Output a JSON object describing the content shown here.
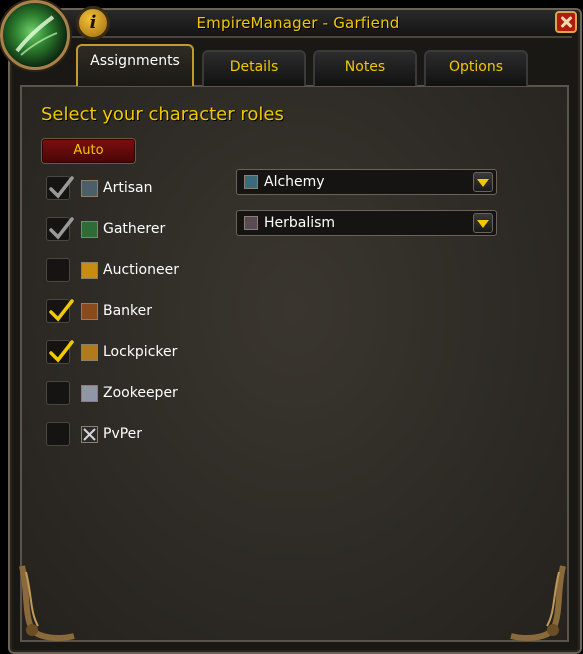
{
  "window": {
    "title": "EmpireManager - Garfiend",
    "info_symbol": "i"
  },
  "tabs": [
    {
      "label": "Assignments",
      "active": true
    },
    {
      "label": "Details",
      "active": false
    },
    {
      "label": "Notes",
      "active": false
    },
    {
      "label": "Options",
      "active": false
    }
  ],
  "main": {
    "heading": "Select your character roles",
    "auto_label": "Auto"
  },
  "roles": [
    {
      "label": "Artisan",
      "checked": true,
      "enabled": false,
      "icon": "artisan-icon"
    },
    {
      "label": "Gatherer",
      "checked": true,
      "enabled": false,
      "icon": "gatherer-icon"
    },
    {
      "label": "Auctioneer",
      "checked": false,
      "enabled": true,
      "icon": "auctioneer-icon"
    },
    {
      "label": "Banker",
      "checked": true,
      "enabled": true,
      "icon": "banker-icon"
    },
    {
      "label": "Lockpicker",
      "checked": true,
      "enabled": true,
      "icon": "lockpicker-icon"
    },
    {
      "label": "Zookeeper",
      "checked": false,
      "enabled": true,
      "icon": "zookeeper-icon"
    },
    {
      "label": "PvPer",
      "checked": false,
      "enabled": true,
      "icon": "pvp-icon"
    }
  ],
  "professions": [
    {
      "label": "Alchemy",
      "icon": "alchemy-icon"
    },
    {
      "label": "Herbalism",
      "icon": "herbalism-icon"
    }
  ],
  "colors": {
    "gold_text": "#f2c800",
    "check_enabled": "#f2c800",
    "check_disabled": "#9a9a9a",
    "auto_button": "#7a0f0f"
  }
}
